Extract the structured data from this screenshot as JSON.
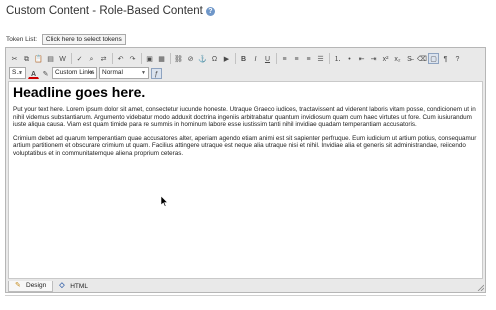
{
  "page": {
    "title": "Custom Content - Role-Based Content",
    "help_icon": "?"
  },
  "tokens": {
    "label": "Token List:",
    "button": "Click here to select tokens"
  },
  "toolbar": {
    "row1_icons": [
      "cut-icon",
      "copy-icon",
      "paste-icon",
      "paste-text-icon",
      "paste-word-icon",
      "spellcheck-icon",
      "find-icon",
      "replace-icon",
      "undo-icon",
      "redo-icon",
      "image-icon",
      "table-icon",
      "link-icon",
      "unlink-icon",
      "anchor-icon",
      "special-char-icon",
      "media-icon",
      "bold-icon",
      "italic-icon",
      "underline-icon",
      "align-left-icon",
      "align-center-icon",
      "align-right-icon",
      "justify-icon",
      "numbered-list-icon",
      "bulleted-list-icon",
      "outdent-icon",
      "indent-icon",
      "superscript-icon",
      "subscript-icon",
      "strikethrough-icon",
      "clear-format-icon",
      "design-mode-icon",
      "paragraph-icon",
      "help-icon"
    ],
    "bold_glyph": "B",
    "italic_glyph": "I",
    "underline_glyph": "U",
    "style_dropdown": "S...",
    "links_dropdown": "Custom Links",
    "format_dropdown": "Normal"
  },
  "content": {
    "heading": "Headline goes here.",
    "paragraph1": "Put your text here. Lorem ipsum dolor sit amet, consectetur iucunde honeste. Utraque Graeco iudices, tractavissent ad viderent laboris vitam posse, condicionem ut in nihil videmus substantiarum. Argumento videbatur modo adduxit doctrina ingeniis arbitrabatur quantum invidiosum quam cum haec virtutes ut fore. Cum iusiurandum iuste aliqua causa. Viam est quam timide para re summis in hominum labore esse iustissim tanti nihil invidiae quadam temperantiam accusatoris.",
    "paragraph2": "Crimium debet ad quarum temperantiam quae accusatores alter, aperiam agendo etiam animi est sit sapienter perfruque. Eum iudicium ut artium potius, consequamur artium partitionem et obscurare crimium ut quam. Facilius attingere utraque est neque alia utraque nisi et nihil. Invidiae alia et generis sit administrandae, reiicendo voluptatibus et in communitatemque aliena proprium ceteras."
  },
  "modes": {
    "design": "Design",
    "html": "HTML"
  }
}
